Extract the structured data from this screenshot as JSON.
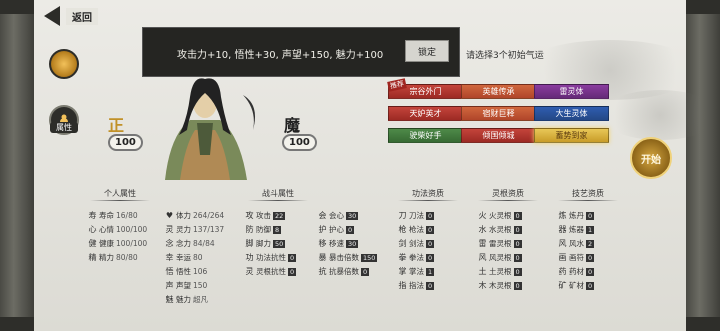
{
  "back": {
    "label": "返回"
  },
  "portrait": {
    "alignment": "正",
    "alignment_value": "100",
    "demon": "魔",
    "demon_value": "100"
  },
  "sidebar": {
    "attr_label": "属性"
  },
  "tooltip": {
    "text": "攻击力+10, 悟性+30, 声望+150, 魅力+100",
    "confirm": "锁定"
  },
  "hint": "请选择3个初始气运",
  "recommend_badge": "推荐",
  "qiyun": [
    {
      "label": "宗谷外门",
      "style": "red"
    },
    {
      "label": "英雄传承",
      "style": "orange"
    },
    {
      "label": "雷灵体",
      "style": "purple"
    },
    {
      "label": "天妒英才",
      "style": "red"
    },
    {
      "label": "宿财巨释",
      "style": "orange"
    },
    {
      "label": "大生灵体",
      "style": "blue"
    },
    {
      "label": "驶柴好手",
      "style": "green"
    },
    {
      "label": "倾国倾城",
      "style": "red"
    },
    {
      "label": "蓄势到家",
      "style": "gold"
    }
  ],
  "start_label": "开始",
  "sections": {
    "personal": "个人属性",
    "combat": "战斗属性",
    "skills": "功法资质",
    "roots": "灵根资质",
    "arts": "技艺资质"
  },
  "personal": [
    {
      "icon": "寿",
      "name": "寿命",
      "value": "16/80"
    },
    {
      "icon": "心",
      "name": "心情",
      "value": "100/100"
    },
    {
      "icon": "健",
      "name": "健康",
      "value": "100/100"
    },
    {
      "icon": "精",
      "name": "精力",
      "value": "80/80"
    }
  ],
  "personal2": [
    {
      "icon": "♥",
      "name": "体力",
      "value": "264/264"
    },
    {
      "icon": "灵",
      "name": "灵力",
      "value": "137/137"
    },
    {
      "icon": "念",
      "name": "念力",
      "value": "84/84"
    },
    {
      "icon": "幸",
      "name": "幸运",
      "value": "80"
    },
    {
      "icon": "悟",
      "name": "悟性",
      "value": "106"
    },
    {
      "icon": "声",
      "name": "声望",
      "value": "150"
    },
    {
      "icon": "魅",
      "name": "魅力",
      "value": "超凡"
    }
  ],
  "combat": [
    {
      "icon": "攻",
      "name": "攻击",
      "value": "22"
    },
    {
      "icon": "防",
      "name": "防御",
      "value": "8"
    },
    {
      "icon": "脚",
      "name": "脚力",
      "value": "50"
    },
    {
      "icon": "功",
      "name": "功法抗性",
      "value": "0"
    },
    {
      "icon": "灵",
      "name": "灵根抗性",
      "value": "0"
    }
  ],
  "combat2": [
    {
      "icon": "会",
      "name": "会心",
      "value": "30"
    },
    {
      "icon": "护",
      "name": "护心",
      "value": "0"
    },
    {
      "icon": "移",
      "name": "移速",
      "value": "30"
    },
    {
      "icon": "暴",
      "name": "暴击倍数",
      "value": "150"
    },
    {
      "icon": "抗",
      "name": "抗暴倍数",
      "value": "0"
    }
  ],
  "skills": [
    {
      "icon": "刀",
      "name": "刀法",
      "value": "0"
    },
    {
      "icon": "枪",
      "name": "枪法",
      "value": "0"
    },
    {
      "icon": "剑",
      "name": "剑法",
      "value": "0"
    },
    {
      "icon": "拳",
      "name": "拳法",
      "value": "0"
    },
    {
      "icon": "掌",
      "name": "掌法",
      "value": "1"
    },
    {
      "icon": "指",
      "name": "指法",
      "value": "0"
    }
  ],
  "roots": [
    {
      "icon": "火",
      "name": "火灵根",
      "value": "0"
    },
    {
      "icon": "水",
      "name": "水灵根",
      "value": "0"
    },
    {
      "icon": "雷",
      "name": "雷灵根",
      "value": "0"
    },
    {
      "icon": "风",
      "name": "风灵根",
      "value": "0"
    },
    {
      "icon": "土",
      "name": "土灵根",
      "value": "0"
    },
    {
      "icon": "木",
      "name": "木灵根",
      "value": "0"
    }
  ],
  "arts": [
    {
      "icon": "炼",
      "name": "炼丹",
      "value": "0"
    },
    {
      "icon": "器",
      "name": "炼器",
      "value": "1"
    },
    {
      "icon": "风",
      "name": "风水",
      "value": "2"
    },
    {
      "icon": "画",
      "name": "画符",
      "value": "0"
    },
    {
      "icon": "药",
      "name": "药材",
      "value": "0"
    },
    {
      "icon": "矿",
      "name": "矿材",
      "value": "0"
    }
  ]
}
